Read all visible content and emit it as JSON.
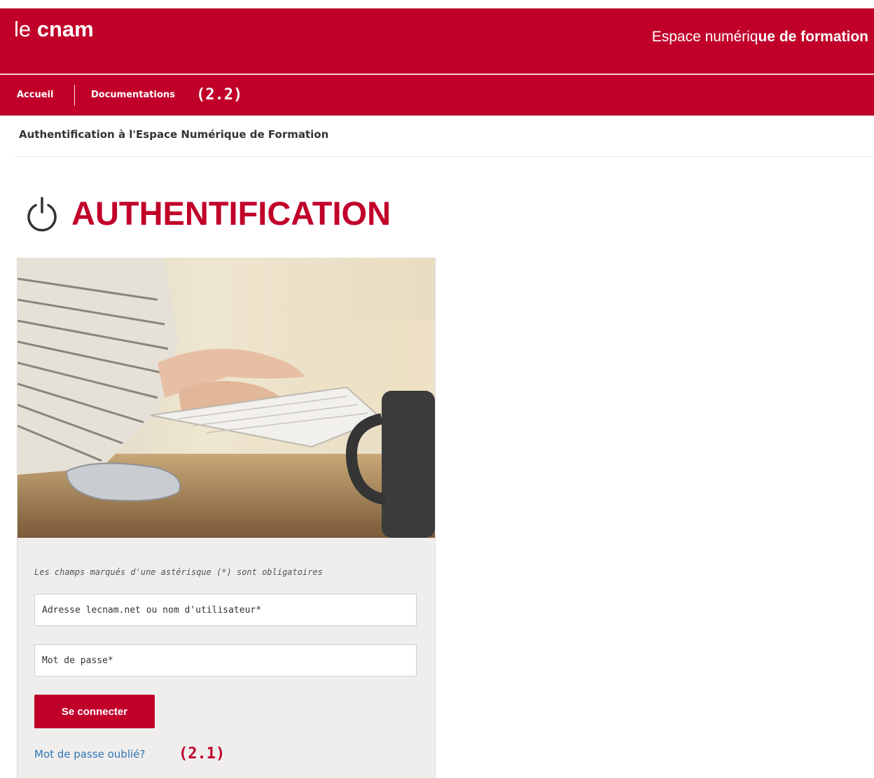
{
  "header": {
    "logo_light": "le ",
    "logo_bold": "cnam",
    "tagline_light": "Espace numériq",
    "tagline_bold": "ue de formation"
  },
  "nav": {
    "items": [
      "Accueil",
      "Documentations"
    ],
    "annotation": "(2.2)"
  },
  "breadcrumb": "Authentification à l'Espace Numérique de Formation",
  "page_title": "AUTHENTIFICATION",
  "form": {
    "required_note": "Les champs marqués d'une astérisque (*) sont obligatoires",
    "username_placeholder": "Adresse lecnam.net ou nom d'utilisateur*",
    "password_placeholder": "Mot de passe*",
    "submit_label": "Se connecter",
    "forgot_label": "Mot de passe oublié?",
    "forgot_annotation": "(2.1)"
  },
  "colors": {
    "brand": "#c1002a",
    "link": "#2e74b5",
    "panel": "#efeeec"
  },
  "icons": [
    "power-icon"
  ]
}
